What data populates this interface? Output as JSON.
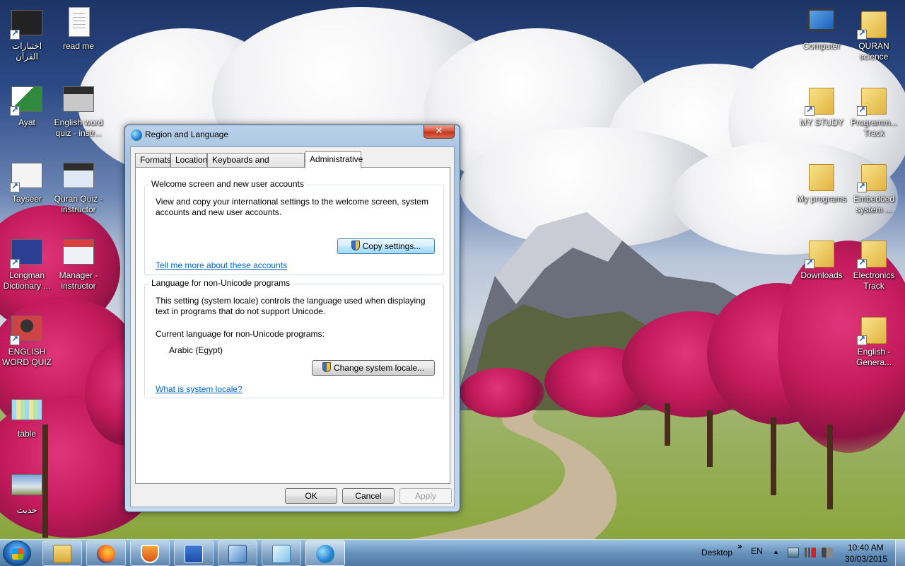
{
  "desktop": {
    "icons_left": [
      {
        "label": "اختبارات القرآن",
        "icon": "quran-tests-icon"
      },
      {
        "label": "read me",
        "icon": "text-document-icon"
      },
      {
        "label": "Ayat",
        "icon": "ayat-icon"
      },
      {
        "label": "English word quiz - instr...",
        "icon": "program-window-icon"
      },
      {
        "label": "Tayseer",
        "icon": "tayseer-icon"
      },
      {
        "label": "Quran Quiz - instructor",
        "icon": "program-window-icon"
      },
      {
        "label": "Longman Dictionary ...",
        "icon": "longman-icon"
      },
      {
        "label": "Manager - instructor",
        "icon": "program-window-icon"
      },
      {
        "label": "ENGLISH WORD QUIZ",
        "icon": "person-photo-icon"
      },
      {
        "label": "table",
        "icon": "image-thumbnail-icon"
      },
      {
        "label": "حديث",
        "icon": "image-thumbnail-icon"
      }
    ],
    "icons_right": [
      {
        "label": "Computer",
        "icon": "computer-icon"
      },
      {
        "label": "QURAN science",
        "icon": "folder-icon"
      },
      {
        "label": "MY STUDY",
        "icon": "folder-icon"
      },
      {
        "label": "Programm... Track",
        "icon": "folder-icon"
      },
      {
        "label": "My programs",
        "icon": "folder-icon"
      },
      {
        "label": "Embedded system ...",
        "icon": "folder-icon"
      },
      {
        "label": "Downloads",
        "icon": "downloads-folder-icon"
      },
      {
        "label": "Electronics Track",
        "icon": "folder-icon"
      },
      {
        "label": "English - Genera...",
        "icon": "folder-icon"
      }
    ]
  },
  "dialog": {
    "title": "Region and Language",
    "close_symbol": "✕",
    "tabs": [
      "Formats",
      "Location",
      "Keyboards and Languages",
      "Administrative"
    ],
    "active_tab": "Administrative",
    "welcome_group": {
      "title": "Welcome screen and new user accounts",
      "description_line1": "View and copy your international settings to the welcome screen, system",
      "description_line2": "accounts and new user accounts.",
      "button": "Copy settings...",
      "link": "Tell me more about these accounts"
    },
    "unicode_group": {
      "title": "Language for non-Unicode programs",
      "description_line1": "This setting (system locale) controls the language used when displaying",
      "description_line2": "text in programs that do not support Unicode.",
      "current_label": "Current language for non-Unicode programs:",
      "current_value": "Arabic (Egypt)",
      "button": "Change system locale...",
      "link": "What is system locale?"
    },
    "buttons": {
      "ok": "OK",
      "cancel": "Cancel",
      "apply": "Apply"
    }
  },
  "taskbar": {
    "apps": [
      {
        "name": "windows-explorer-icon",
        "state": "pinned"
      },
      {
        "name": "firefox-icon",
        "state": "pinned"
      },
      {
        "name": "security-shield-icon",
        "state": "pinned"
      },
      {
        "name": "word-icon",
        "state": "pinned"
      },
      {
        "name": "virtualbox-icon",
        "state": "pinned"
      },
      {
        "name": "notepad-icon",
        "state": "pinned"
      },
      {
        "name": "region-language-icon",
        "state": "active"
      }
    ],
    "desktop_label": "Desktop",
    "chevron": "»",
    "language": "EN",
    "tray_expand": "▲",
    "time": "10:40 AM",
    "date": "30/03/2015"
  }
}
